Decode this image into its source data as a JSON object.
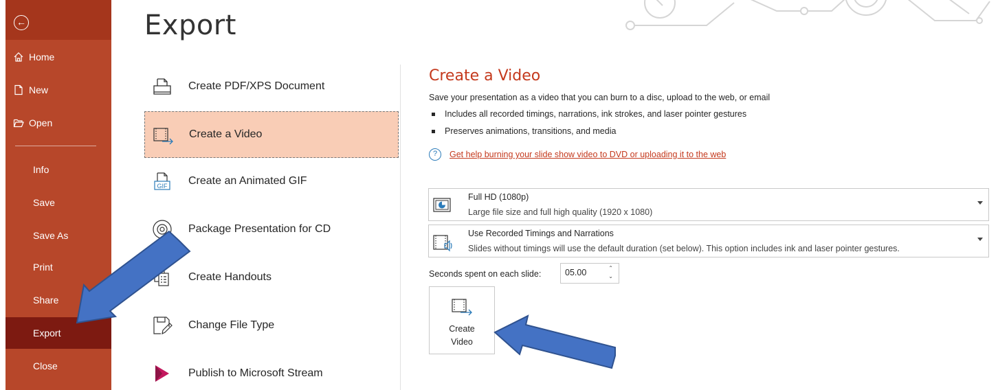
{
  "sidebar": {
    "items": [
      {
        "label": "Home",
        "icon": "home-icon"
      },
      {
        "label": "New",
        "icon": "new-document-icon"
      },
      {
        "label": "Open",
        "icon": "open-folder-icon"
      },
      {
        "label": "Info"
      },
      {
        "label": "Save"
      },
      {
        "label": "Save As"
      },
      {
        "label": "Print"
      },
      {
        "label": "Share"
      },
      {
        "label": "Export",
        "selected": true
      },
      {
        "label": "Close"
      }
    ]
  },
  "page": {
    "title": "Export"
  },
  "options": [
    {
      "label": "Create PDF/XPS Document",
      "icon": "pdf-document-icon"
    },
    {
      "label": "Create a Video",
      "icon": "video-icon",
      "selected": true
    },
    {
      "label": "Create an Animated GIF",
      "icon": "gif-icon"
    },
    {
      "label": "Package Presentation for CD",
      "icon": "cd-icon"
    },
    {
      "label": "Create Handouts",
      "icon": "handouts-icon"
    },
    {
      "label": "Change File Type",
      "icon": "change-file-type-icon"
    },
    {
      "label": "Publish to Microsoft Stream",
      "icon": "stream-icon"
    }
  ],
  "pane": {
    "title": "Create a Video",
    "description": "Save your presentation as a video that you can burn to a disc, upload to the web, or email",
    "bullets": [
      "Includes all recorded timings, narrations, ink strokes, and laser pointer gestures",
      "Preserves animations, transitions, and media"
    ],
    "help_link": "Get help burning your slide show video to DVD or uploading it to the web",
    "quality": {
      "title": "Full HD (1080p)",
      "subtitle": "Large file size and full high quality (1920 x 1080)"
    },
    "timing": {
      "title": "Use Recorded Timings and Narrations",
      "subtitle": "Slides without timings will use the default duration (set below). This option includes ink and laser pointer gestures."
    },
    "seconds_label": "Seconds spent on each slide:",
    "seconds_value": "05.00",
    "create_button": {
      "line1": "Create",
      "line2": "Video"
    }
  },
  "colors": {
    "sidebar": "#b7472a",
    "sidebar_selected": "#7d1a11",
    "accent": "#c4391d",
    "option_selected": "#f9cdb6",
    "annotation_arrow": "#4472c4"
  }
}
